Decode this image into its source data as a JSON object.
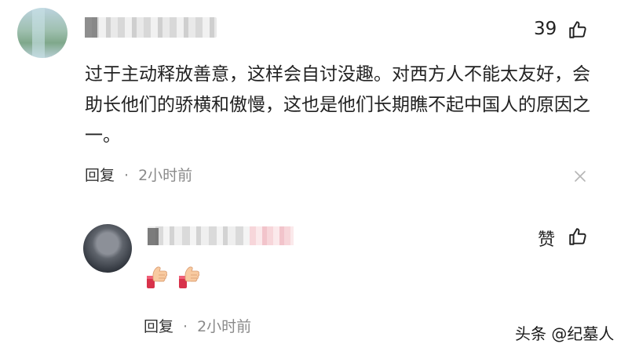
{
  "comment": {
    "like_count": "39",
    "text": "过于主动释放善意，这样会自讨没趣。对西方人不能太友好，会助长他们的骄横和傲慢，这也是他们长期瞧不起中国人的原因之一。",
    "reply_label": "回复",
    "separator": "·",
    "time": "2小时前"
  },
  "reply": {
    "like_label": "赞",
    "emojis": [
      "clap-emoji",
      "clap-emoji"
    ],
    "reply_label": "回复",
    "separator": "·",
    "time": "2小时前"
  },
  "watermark": "头条 @纪墓人",
  "icons": {
    "like": "thumbs-up-icon",
    "close": "close-icon"
  },
  "colors": {
    "text": "#222222",
    "meta": "#8a8a8a",
    "background": "#ffffff"
  }
}
